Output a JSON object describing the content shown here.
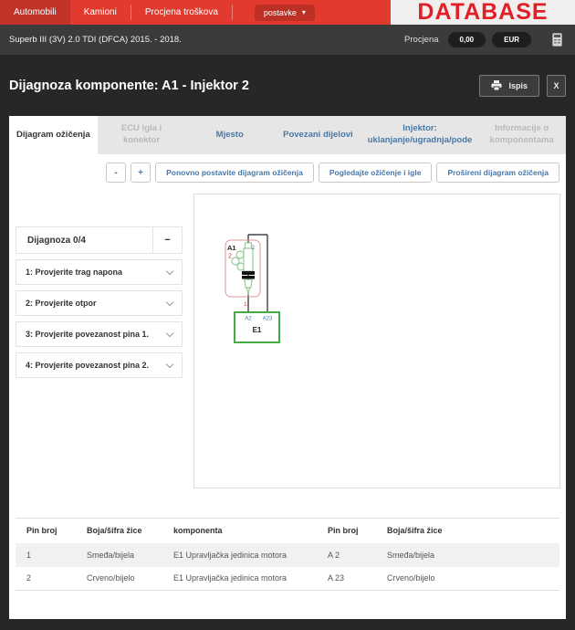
{
  "nav": {
    "items": [
      {
        "label": "Automobili",
        "active": true
      },
      {
        "label": "Kamioni",
        "active": false
      },
      {
        "label": "Procjena troškova",
        "active": false
      }
    ],
    "settings_label": "postavke",
    "settings_caret": "▾",
    "brand": "DATABASE",
    "brand_color": "#e01f26",
    "bar_color": "#e23a2e"
  },
  "vehicle_bar": {
    "vehicle": "Superb III (3V) 2.0 TDI (DFCA) 2015. - 2018.",
    "estimate_label": "Procjena",
    "estimate_value": "0,00",
    "currency": "EUR"
  },
  "dialog": {
    "title": "Dijagnoza komponente: A1 - Injektor 2",
    "print_label": "Ispis",
    "close_label": "X"
  },
  "tabs": [
    {
      "label": "Dijagram ožičenja",
      "state": "active"
    },
    {
      "label": "ECU igla i konektor",
      "state": "disabled"
    },
    {
      "label": "Mjesto",
      "state": "enabled"
    },
    {
      "label": "Povezani dijelovi",
      "state": "enabled"
    },
    {
      "label": "Injektor: uklanjanje/ugradnja/pode",
      "state": "enabled"
    },
    {
      "label": "Informacije o komponentama",
      "state": "disabled"
    }
  ],
  "toolbar": {
    "zoom_out_label": "-",
    "zoom_in_label": "+",
    "reset_label": "Ponovno postavite dijagram ožičenja",
    "view_wiring_label": "Pogledajte ožičenje i igle",
    "extended_label": "Prošireni dijagram ožičenja"
  },
  "diagnosis": {
    "header": "Dijagnoza 0/4",
    "collapse_glyph": "−",
    "steps": [
      "1: Provjerite trag napona",
      "2: Provjerite otpor",
      "3: Provjerite povezanost pina 1.",
      "4: Provjerite povezanost pina 2."
    ]
  },
  "diagram": {
    "component_id": "A1",
    "component_pin_count": "2",
    "pin_top": "2",
    "pin_bottom": "1",
    "ecu_id": "E1",
    "ecu_pins": [
      "A2",
      "A23"
    ],
    "colors": {
      "connector_outline": "#dc9a9a",
      "injector_outline": "#99cc99",
      "ecu_box": "#44aa44",
      "wire": "#222222",
      "pin_label_blue": "#4878a8",
      "pin_label_red": "#cc3333"
    }
  },
  "pin_table": {
    "headers": [
      "Pin broj",
      "Boja/šifra žice",
      "komponenta",
      "Pin broj",
      "Boja/šifra žice"
    ],
    "rows": [
      [
        "1",
        "Smeđa/bijela",
        "E1 Upravljačka jedinica motora",
        "A 2",
        "Smeđa/bijela"
      ],
      [
        "2",
        "Crveno/bijelo",
        "E1 Upravljačka jedinica motora",
        "A 23",
        "Crveno/bijelo"
      ]
    ]
  }
}
